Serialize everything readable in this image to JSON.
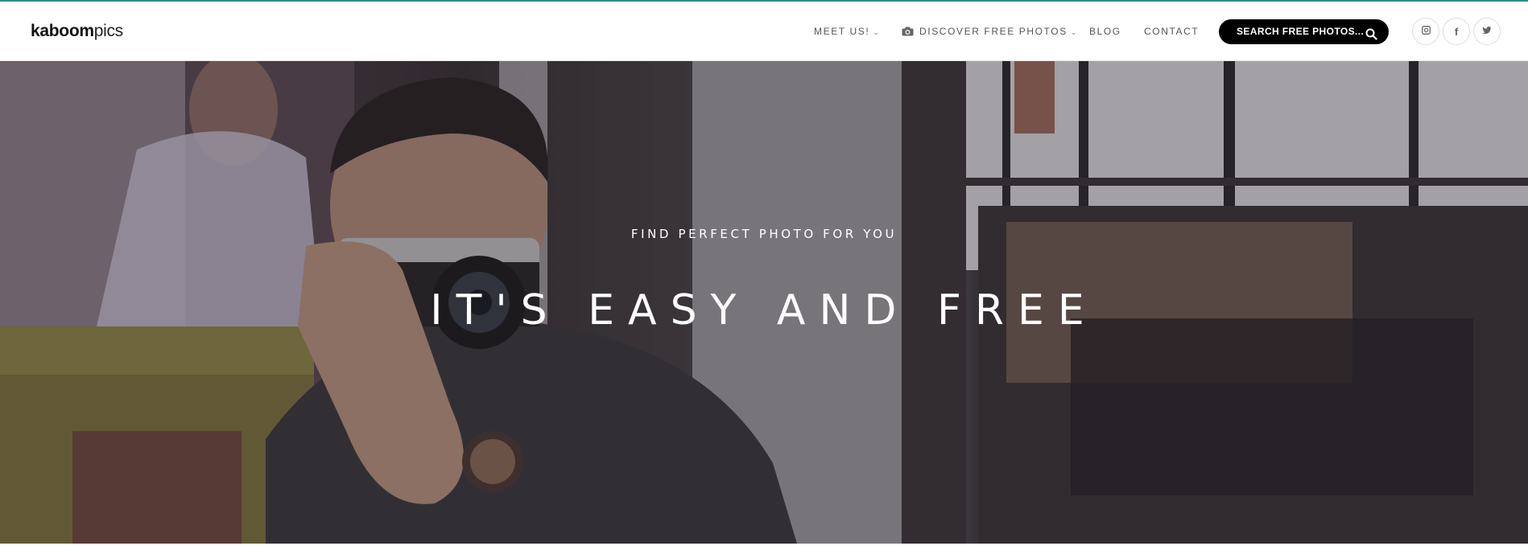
{
  "brand": {
    "logo_bold": "kaboom",
    "logo_light": "pics"
  },
  "nav": {
    "items": [
      {
        "label": "MEET US!",
        "has_dropdown": true
      },
      {
        "label": "DISCOVER FREE PHOTOS",
        "has_dropdown": true,
        "icon": "camera-icon"
      },
      {
        "label": "BLOG",
        "has_dropdown": false
      },
      {
        "label": "CONTACT",
        "has_dropdown": false
      }
    ],
    "search": {
      "placeholder": "SEARCH FREE PHOTOS...",
      "icon": "search-icon"
    },
    "social": [
      {
        "icon": "instagram-icon"
      },
      {
        "icon": "facebook-icon",
        "glyph": "f"
      },
      {
        "icon": "twitter-icon"
      }
    ]
  },
  "hero": {
    "subtitle": "FIND PERFECT PHOTO FOR YOU",
    "title": "IT'S EASY AND FREE"
  },
  "colors": {
    "accent_line": "#2f8f8a",
    "search_bg": "#000000",
    "nav_text": "#555555"
  }
}
